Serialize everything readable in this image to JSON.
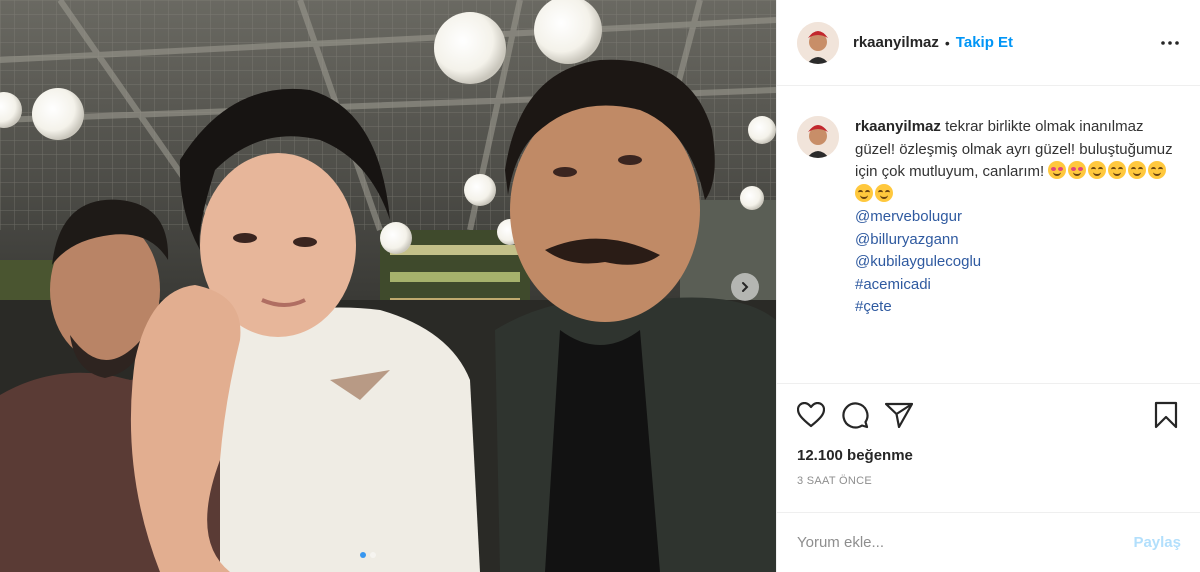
{
  "post": {
    "author": "rkaanyilmaz",
    "follow_separator": "•",
    "follow_label": "Takip Et",
    "caption": {
      "username": "rkaanyilmaz",
      "text": "tekrar birlikte olmak inanılmaz güzel! özleşmiş olmak ayrı güzel! buluştuğumuz için çok mutluyum, canlarım!",
      "tags": [
        "@mervebolugur",
        "@billuryazgann",
        "@kubilaygulecoglu",
        "#acemicadi",
        "#çete"
      ]
    },
    "likes_text": "12.100 beğenme",
    "time_text": "3 SAAT ÖNCE",
    "comment": {
      "placeholder": "Yorum ekle...",
      "post_label": "Paylaş"
    }
  },
  "icons": {
    "more": "more-options-icon",
    "like": "heart-icon",
    "comment": "comment-icon",
    "share": "paper-plane-icon",
    "save": "bookmark-icon",
    "carousel": "chevron-right-icon"
  },
  "colors": {
    "link": "#0095f6",
    "hashtag": "#2f5aa0",
    "muted": "#8e8e8e",
    "post_disabled": "#b2dffc"
  }
}
